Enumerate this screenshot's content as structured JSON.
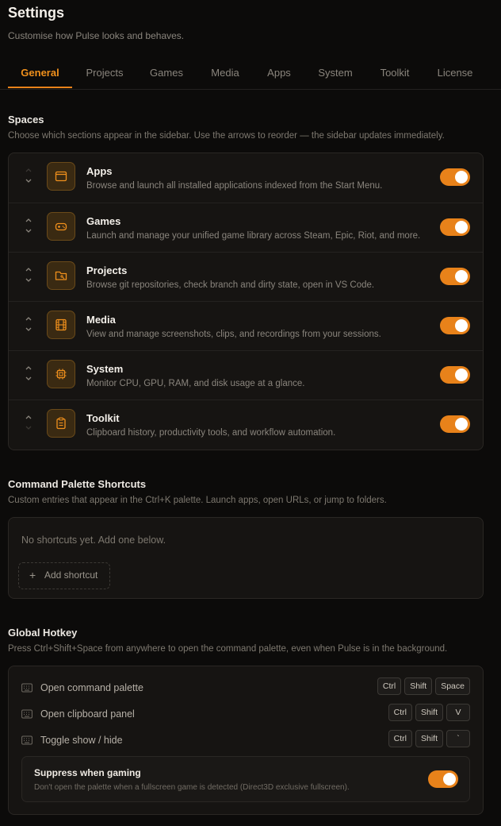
{
  "header": {
    "title": "Settings",
    "subtitle": "Customise how Pulse looks and behaves."
  },
  "tabs": [
    {
      "label": "General",
      "active": true
    },
    {
      "label": "Projects",
      "active": false
    },
    {
      "label": "Games",
      "active": false
    },
    {
      "label": "Media",
      "active": false
    },
    {
      "label": "Apps",
      "active": false
    },
    {
      "label": "System",
      "active": false
    },
    {
      "label": "Toolkit",
      "active": false
    },
    {
      "label": "License",
      "active": false
    }
  ],
  "spaces": {
    "title": "Spaces",
    "description": "Choose which sections appear in the sidebar. Use the arrows to reorder — the sidebar updates immediately.",
    "items": [
      {
        "name": "Apps",
        "description": "Browse and launch all installed applications indexed from the Start Menu.",
        "icon": "window-icon",
        "enabled": true
      },
      {
        "name": "Games",
        "description": "Launch and manage your unified game library across Steam, Epic, Riot, and more.",
        "icon": "gamepad-icon",
        "enabled": true
      },
      {
        "name": "Projects",
        "description": "Browse git repositories, check branch and dirty state, open in VS Code.",
        "icon": "folder-git-icon",
        "enabled": true
      },
      {
        "name": "Media",
        "description": "View and manage screenshots, clips, and recordings from your sessions.",
        "icon": "film-icon",
        "enabled": true
      },
      {
        "name": "System",
        "description": "Monitor CPU, GPU, RAM, and disk usage at a glance.",
        "icon": "cpu-icon",
        "enabled": true
      },
      {
        "name": "Toolkit",
        "description": "Clipboard history, productivity tools, and workflow automation.",
        "icon": "clipboard-icon",
        "enabled": true
      }
    ]
  },
  "shortcuts": {
    "title": "Command Palette Shortcuts",
    "description": "Custom entries that appear in the Ctrl+K palette. Launch apps, open URLs, or jump to folders.",
    "empty_text": "No shortcuts yet. Add one below.",
    "add_label": "Add shortcut"
  },
  "hotkey": {
    "title": "Global Hotkey",
    "description": "Press Ctrl+Shift+Space from anywhere to open the command palette, even when Pulse is in the background.",
    "rows": [
      {
        "label": "Open command palette",
        "keys": [
          "Ctrl",
          "Shift",
          "Space"
        ]
      },
      {
        "label": "Open clipboard panel",
        "keys": [
          "Ctrl",
          "Shift",
          "V"
        ]
      },
      {
        "label": "Toggle show / hide",
        "keys": [
          "Ctrl",
          "Shift",
          "`"
        ]
      }
    ],
    "suppress": {
      "title": "Suppress when gaming",
      "description": "Don't open the palette when a fullscreen game is detected (Direct3D exclusive fullscreen).",
      "enabled": true
    }
  },
  "colors": {
    "accent": "#e8821a",
    "background": "#0c0b0a",
    "panel": "#161412"
  }
}
